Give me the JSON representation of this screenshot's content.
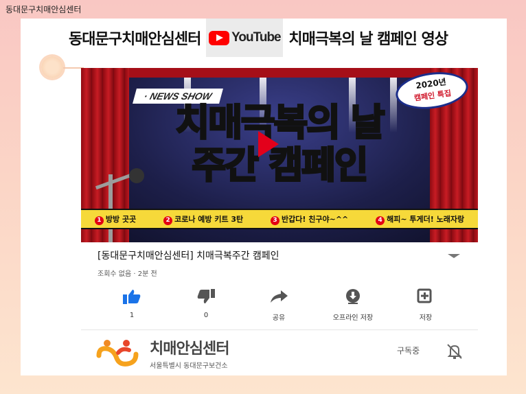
{
  "corner_label": "동대문구치매안심센터",
  "headline": {
    "left": "동대문구치매안심센터",
    "badge": "YouTube",
    "right": "치매극복의 날 캠페인 영상"
  },
  "thumbnail": {
    "tag": "· NEWS SHOW",
    "badge_year": "2020년",
    "badge_sub": "캠페인 특집",
    "title_line1": "치매극복의 날",
    "title_line2": "주간 캠페인",
    "ribbon": [
      {
        "num": "1",
        "text": "방방 곳곳"
      },
      {
        "num": "2",
        "text": "코로나 예방 키트 3탄"
      },
      {
        "num": "3",
        "text": "반갑다! 친구야~^^"
      },
      {
        "num": "4",
        "text": "해피~ 투게더! 노래자랑"
      }
    ]
  },
  "video": {
    "title": "[동대문구치매안심센터] 치매극복주간 캠페인",
    "meta": "조회수 없음 · 2분 전"
  },
  "actions": [
    {
      "icon": "thumbs-up-icon",
      "label": "1"
    },
    {
      "icon": "thumbs-down-icon",
      "label": "0"
    },
    {
      "icon": "share-icon",
      "label": "공유"
    },
    {
      "icon": "download-icon",
      "label": "오프라인 저장"
    },
    {
      "icon": "playlist-add-icon",
      "label": "저장"
    }
  ],
  "channel": {
    "name": "치매안심센터",
    "sub": "서울특별시 동대문구보건소",
    "subscribe_status": "구독중"
  },
  "colors": {
    "youtube_red": "#ff0000",
    "like_blue": "#1a73e8",
    "thumb_yellow": "#ffe640"
  }
}
